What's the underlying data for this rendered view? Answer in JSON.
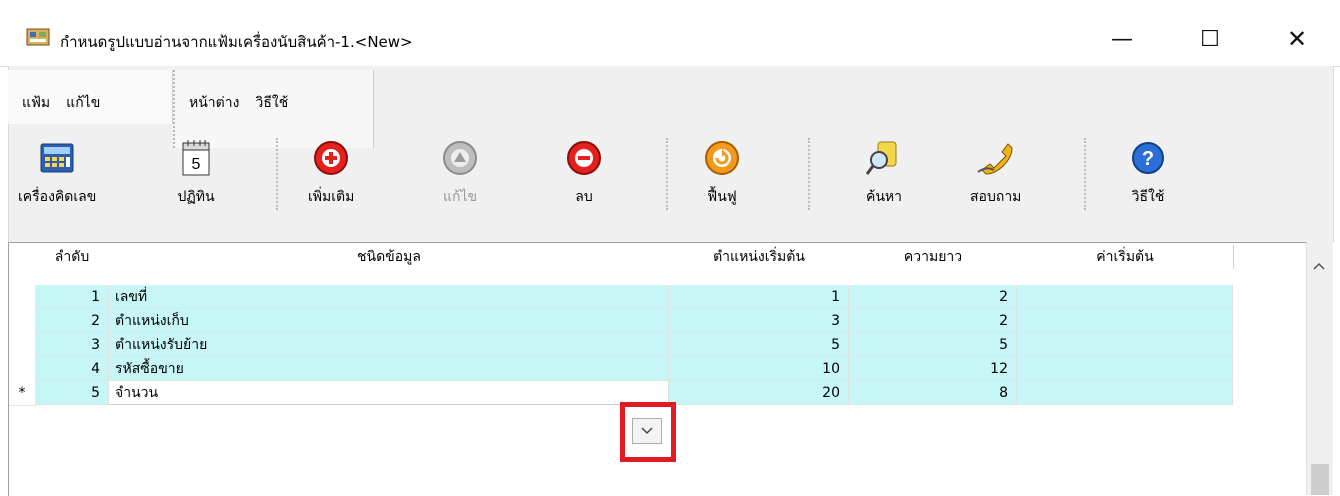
{
  "window": {
    "title": "กำหนดรูปแบบอ่านจากแฟ้มเครื่องนับสินค้า-1.<New>",
    "minimize": "—",
    "maximize": "☐",
    "close": "✕"
  },
  "menu": {
    "file": "แฟ้ม",
    "edit": "แก้ไข",
    "window": "หน้าต่าง",
    "help": "วิธีใช้"
  },
  "toolbar": {
    "calculator": "เครื่องคิดเลข",
    "calendar": "ปฏิทิน",
    "calendar_day": "5",
    "add": "เพิ่มเติม",
    "edit": "แก้ไข",
    "delete": "ลบ",
    "restore": "ฟื้นฟู",
    "search": "ค้นหา",
    "inquiry": "สอบถาม",
    "help": "วิธีใช้"
  },
  "table": {
    "headers": [
      "ลำดับ",
      "ชนิดข้อมูล",
      "ตำแหน่งเริ่มต้น",
      "ความยาว",
      "ค่าเริ่มต้น"
    ],
    "rows": [
      {
        "no": "1",
        "type": "เลขที่",
        "start": "1",
        "length": "2",
        "default": ""
      },
      {
        "no": "2",
        "type": "ตำแหน่งเก็บ",
        "start": "3",
        "length": "2",
        "default": ""
      },
      {
        "no": "3",
        "type": "ตำแหน่งรับย้าย",
        "start": "5",
        "length": "5",
        "default": ""
      },
      {
        "no": "4",
        "type": "รหัสซื้อขาย",
        "start": "10",
        "length": "12",
        "default": ""
      },
      {
        "no": "5",
        "type": "จำนวน",
        "start": "20",
        "length": "8",
        "default": "",
        "marker": "*"
      }
    ]
  },
  "colors": {
    "row_cyan": "#c7f6f6",
    "highlight_red": "#e01b22"
  }
}
